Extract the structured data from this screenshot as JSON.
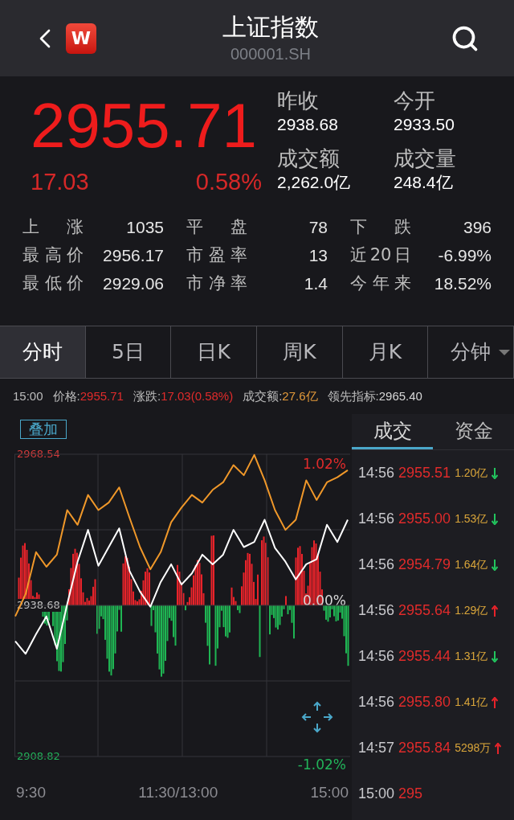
{
  "header": {
    "title": "上证指数",
    "code": "000001.SH",
    "logo_letter": "W"
  },
  "quote": {
    "price": "2955.71",
    "change": "17.03",
    "change_pct": "0.58%",
    "fields": [
      {
        "label": "昨收",
        "value": "2938.68"
      },
      {
        "label": "今开",
        "value": "2933.50"
      },
      {
        "label": "成交额",
        "value": "2,262.0亿"
      },
      {
        "label": "成交量",
        "value": "248.4亿"
      }
    ]
  },
  "stats": [
    {
      "label": "上 涨",
      "value": "1035"
    },
    {
      "label": "平 盘",
      "value": "78"
    },
    {
      "label": "下 跌",
      "value": "396"
    },
    {
      "label": "最高价",
      "value": "2956.17"
    },
    {
      "label": "市盈率",
      "value": "13"
    },
    {
      "label": "近20日",
      "value": "-6.99%"
    },
    {
      "label": "最低价",
      "value": "2929.06"
    },
    {
      "label": "市净率",
      "value": "1.4"
    },
    {
      "label": "今年来",
      "value": "18.52%"
    }
  ],
  "tabs": [
    {
      "label": "分时",
      "selected": true,
      "dropdown": false
    },
    {
      "label": "5日",
      "selected": false,
      "dropdown": false
    },
    {
      "label": "日K",
      "selected": false,
      "dropdown": false
    },
    {
      "label": "周K",
      "selected": false,
      "dropdown": false
    },
    {
      "label": "月K",
      "selected": false,
      "dropdown": false
    },
    {
      "label": "分钟",
      "selected": false,
      "dropdown": true
    }
  ],
  "info_line": [
    {
      "label": "15:00",
      "kind": "time"
    },
    {
      "label": "价格:",
      "value": "2955.71",
      "kind": "up"
    },
    {
      "label": "涨跌:",
      "value": "17.03(0.58%)",
      "kind": "up"
    },
    {
      "label": "成交额:",
      "value": "27.6亿",
      "kind": "amount"
    },
    {
      "label": "领先指标:",
      "value": "2965.40",
      "kind": "plain"
    }
  ],
  "chart": {
    "overlay_button": "叠加",
    "percent_labels": [
      {
        "label": "1.02%",
        "kind": "up"
      },
      {
        "label": "0.00%",
        "kind": "flat"
      },
      {
        "label": "-1.02%",
        "kind": "down"
      }
    ],
    "time_labels": [
      "9:30",
      "11:30/13:00",
      "15:00"
    ],
    "chart_data": {
      "type": "line",
      "series": [
        {
          "color": "#ffffff",
          "values": [
            2931.6,
            2929.1,
            2933.0,
            2936.5,
            2930.1,
            2938.9,
            2947.3,
            2953.6,
            2946.5,
            2950.2,
            2953.9,
            2945.5,
            2941.4,
            2938.4,
            2943.3,
            2946.8,
            2942.8,
            2945.0,
            2948.7,
            2946.8,
            2948.7,
            2953.6,
            2950.2,
            2951.2,
            2955.6,
            2950.0,
            2947.3,
            2943.8,
            2946.8,
            2947.8,
            2954.6,
            2951.2,
            2955.6
          ]
        },
        {
          "color": "#f0982a",
          "values": [
            2936.5,
            2940.9,
            2949.2,
            2946.3,
            2948.7,
            2957.5,
            2954.6,
            2960.5,
            2957.5,
            2959.0,
            2962.0,
            2956.0,
            2950.2,
            2945.8,
            2949.2,
            2955.1,
            2958.0,
            2960.5,
            2959.0,
            2961.5,
            2963.0,
            2966.4,
            2964.4,
            2968.4,
            2963.4,
            2957.5,
            2953.6,
            2955.6,
            2963.4,
            2959.5,
            2963.0,
            2964.0,
            2965.4
          ]
        }
      ],
      "ylim": [
        2908.82,
        2968.54
      ],
      "grid": true,
      "yticks": [
        {
          "value": 2968.54,
          "label": "2968.54"
        },
        {
          "value": 2938.68,
          "label": "2938.68"
        },
        {
          "value": 2908.82,
          "label": "2908.82"
        }
      ]
    }
  },
  "trade_tabs": [
    {
      "label": "成交",
      "selected": true
    },
    {
      "label": "资金",
      "selected": false
    }
  ],
  "trades": [
    {
      "time": "14:56",
      "price": "2955.51",
      "amount": "1.20亿",
      "rising": false
    },
    {
      "time": "14:56",
      "price": "2955.00",
      "amount": "1.53亿",
      "rising": false
    },
    {
      "time": "14:56",
      "price": "2954.79",
      "amount": "1.64亿",
      "rising": false
    },
    {
      "time": "14:56",
      "price": "2955.64",
      "amount": "1.29亿",
      "rising": true
    },
    {
      "time": "14:56",
      "price": "2955.44",
      "amount": "1.31亿",
      "rising": false
    },
    {
      "time": "14:56",
      "price": "2955.80",
      "amount": "1.41亿",
      "rising": true
    },
    {
      "time": "14:57",
      "price": "2955.84",
      "amount": "5298万",
      "rising": true
    },
    {
      "time": "15:00",
      "price": "295"
    }
  ]
}
